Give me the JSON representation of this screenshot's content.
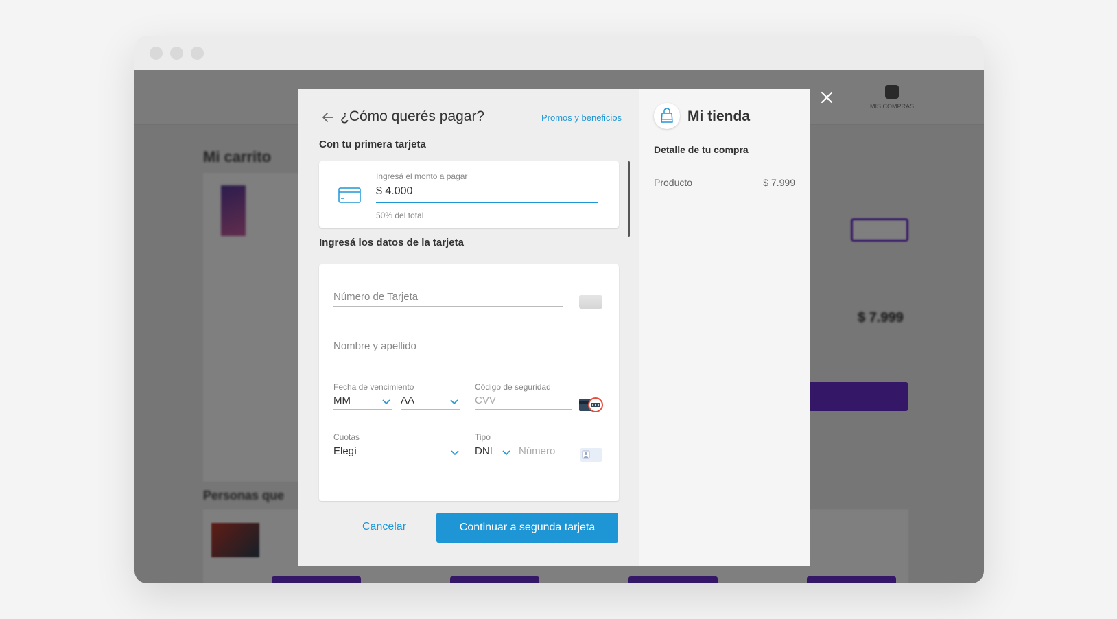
{
  "background_page": {
    "cart_title": "Mi carrito",
    "bag_label": "MIS COMPRAS",
    "total": "$ 7.999",
    "people_section": "Personas que"
  },
  "modal": {
    "title": "¿Cómo querés pagar?",
    "promos_link": "Promos y beneficios",
    "first_card_section": "Con tu primera tarjeta",
    "amount": {
      "label": "Ingresá el monto a pagar",
      "value": "$ 4.000",
      "hint": "50% del total"
    },
    "card_data_section": "Ingresá los datos de la tarjeta",
    "form": {
      "card_number_placeholder": "Número de Tarjeta",
      "name_placeholder": "Nombre y apellido",
      "expiry_label": "Fecha de vencimiento",
      "month_value": "MM",
      "year_value": "AA",
      "security_label": "Código de seguridad",
      "cvv_placeholder": "CVV",
      "installments_label": "Cuotas",
      "installments_value": "Elegí",
      "doc_type_label": "Tipo",
      "doc_type_value": "DNI",
      "doc_number_placeholder": "Número"
    },
    "cancel_label": "Cancelar",
    "continue_label": "Continuar a segunda tarjeta"
  },
  "summary": {
    "store_name": "Mi tienda",
    "detail_title": "Detalle de tu compra",
    "items": [
      {
        "label": "Producto",
        "price": "$ 7.999"
      }
    ]
  },
  "colors": {
    "accent": "#1e96d6",
    "brand_purple": "#6a2fd0"
  }
}
